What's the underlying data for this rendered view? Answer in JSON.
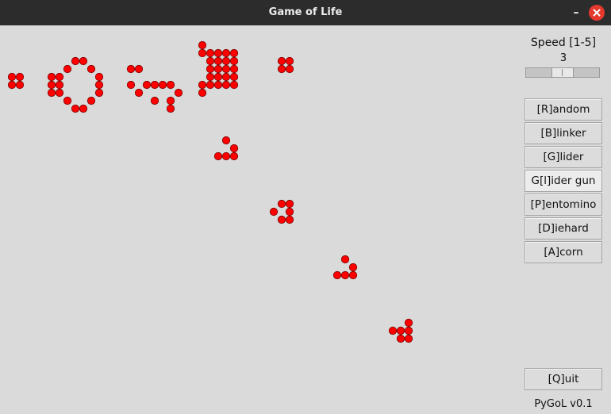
{
  "window": {
    "title": "Game of Life",
    "minimize_glyph": "–"
  },
  "board": {
    "cell_color": "#ff0000",
    "cell_outline": "#7a0000",
    "live_cells": [
      [
        1,
        6
      ],
      [
        2,
        6
      ],
      [
        1,
        7
      ],
      [
        2,
        7
      ],
      [
        6,
        6
      ],
      [
        6,
        7
      ],
      [
        6,
        8
      ],
      [
        7,
        6
      ],
      [
        7,
        7
      ],
      [
        7,
        8
      ],
      [
        8,
        5
      ],
      [
        8,
        9
      ],
      [
        9,
        4
      ],
      [
        9,
        10
      ],
      [
        10,
        4
      ],
      [
        10,
        10
      ],
      [
        11,
        5
      ],
      [
        11,
        9
      ],
      [
        12,
        6
      ],
      [
        12,
        7
      ],
      [
        12,
        8
      ],
      [
        16,
        5
      ],
      [
        17,
        5
      ],
      [
        16,
        7
      ],
      [
        18,
        7
      ],
      [
        17,
        8
      ],
      [
        19,
        7
      ],
      [
        19,
        9
      ],
      [
        20,
        7
      ],
      [
        21,
        7
      ],
      [
        22,
        8
      ],
      [
        21,
        9
      ],
      [
        21,
        10
      ],
      [
        25,
        2
      ],
      [
        25,
        3
      ],
      [
        26,
        3
      ],
      [
        25,
        7
      ],
      [
        25,
        8
      ],
      [
        26,
        7
      ],
      [
        26,
        4
      ],
      [
        27,
        4
      ],
      [
        28,
        4
      ],
      [
        26,
        5
      ],
      [
        27,
        5
      ],
      [
        28,
        5
      ],
      [
        26,
        6
      ],
      [
        27,
        6
      ],
      [
        28,
        6
      ],
      [
        27,
        3
      ],
      [
        28,
        3
      ],
      [
        29,
        3
      ],
      [
        27,
        7
      ],
      [
        28,
        7
      ],
      [
        29,
        7
      ],
      [
        29,
        4
      ],
      [
        29,
        5
      ],
      [
        29,
        6
      ],
      [
        35,
        4
      ],
      [
        36,
        4
      ],
      [
        35,
        5
      ],
      [
        36,
        5
      ],
      [
        28,
        14
      ],
      [
        29,
        15
      ],
      [
        27,
        16
      ],
      [
        28,
        16
      ],
      [
        29,
        16
      ],
      [
        34,
        23
      ],
      [
        35,
        22
      ],
      [
        36,
        22
      ],
      [
        35,
        24
      ],
      [
        36,
        24
      ],
      [
        36,
        23
      ],
      [
        43,
        29
      ],
      [
        44,
        30
      ],
      [
        42,
        31
      ],
      [
        43,
        31
      ],
      [
        44,
        31
      ],
      [
        49,
        38
      ],
      [
        50,
        38
      ],
      [
        51,
        37
      ],
      [
        51,
        38
      ],
      [
        51,
        39
      ],
      [
        50,
        39
      ]
    ]
  },
  "sidebar": {
    "speed_label": "Speed [1-5]",
    "speed_value": "3",
    "speed_level": 3,
    "speed_min": 1,
    "speed_max": 5,
    "buttons": [
      {
        "label": "[R]andom"
      },
      {
        "label": "[B]linker"
      },
      {
        "label": "[G]lider"
      },
      {
        "label": "G[l]ider gun"
      },
      {
        "label": "[P]entomino"
      },
      {
        "label": "[D]iehard"
      },
      {
        "label": "[A]corn"
      }
    ],
    "quit_label": "[Q]uit",
    "version": "PyGoL v0.1"
  }
}
